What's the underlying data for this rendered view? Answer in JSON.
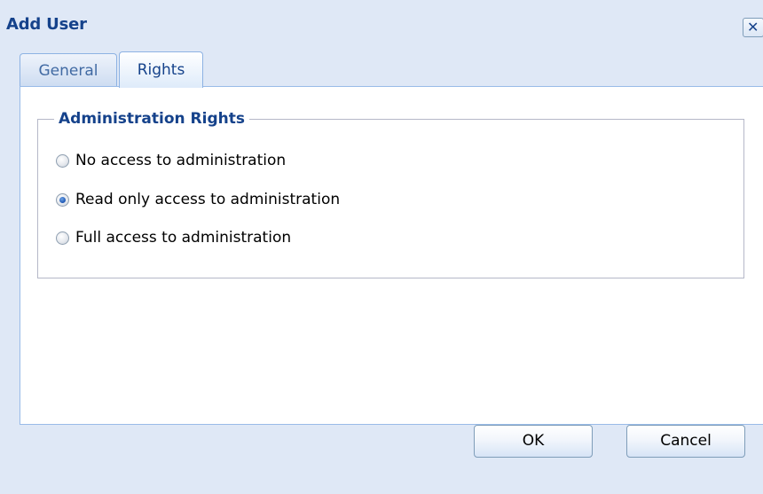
{
  "dialog": {
    "title": "Add User",
    "close_icon": "close-icon"
  },
  "tabs": [
    {
      "label": "General",
      "active": false
    },
    {
      "label": "Rights",
      "active": true
    }
  ],
  "rights": {
    "legend": "Administration Rights",
    "options": [
      {
        "label": "No access to administration",
        "checked": false
      },
      {
        "label": "Read only access to administration",
        "checked": true
      },
      {
        "label": "Full access to administration",
        "checked": false
      }
    ]
  },
  "buttons": {
    "ok_label": "OK",
    "cancel_label": "Cancel"
  },
  "colors": {
    "title": "#15428b",
    "window_background": "#dfe8f6",
    "panel_border": "#99bbe8"
  }
}
